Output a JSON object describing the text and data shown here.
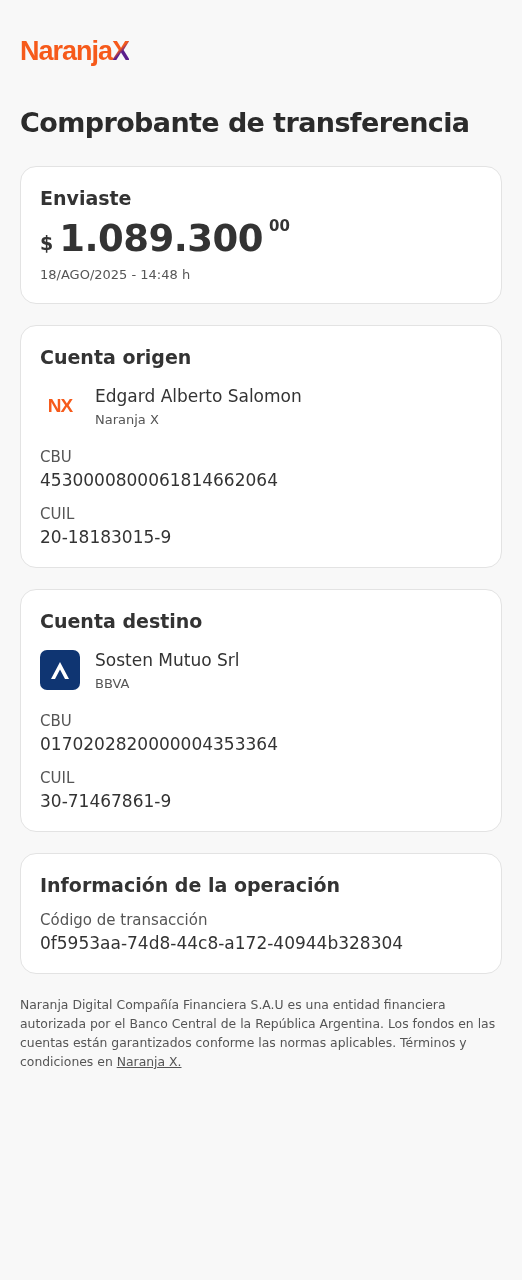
{
  "logo": {
    "name": "Naranja",
    "mark": "X"
  },
  "title": "Comprobante de transferencia",
  "summary": {
    "label": "Enviaste",
    "currency": "$",
    "amount": "1.089.300",
    "cents": "00",
    "datetime": "18/AGO/2025 - 14:48 h"
  },
  "accounts": [
    {
      "title": "Cuenta origen",
      "kind": "naranja",
      "logo_text": "NX",
      "holder": "Edgard Alberto Salomon",
      "bank": "Naranja X",
      "fields": [
        {
          "label": "CBU",
          "value": "4530000800061814662064"
        },
        {
          "label": "CUIL",
          "value": "20-18183015-9"
        }
      ]
    },
    {
      "title": "Cuenta destino",
      "kind": "bank",
      "holder": "Sosten Mutuo Srl",
      "bank": "BBVA",
      "fields": [
        {
          "label": "CBU",
          "value": "0170202820000004353364"
        },
        {
          "label": "CUIL",
          "value": "30-71467861-9"
        }
      ]
    }
  ],
  "operation": {
    "title": "Información de la operación",
    "fields": [
      {
        "label": "Código de transacción",
        "value": "0f5953aa-74d8-44c8-a172-40944b328304"
      }
    ]
  },
  "footer": {
    "text": "Naranja Digital Compañía Financiera S.A.U es una entidad financiera autorizada por el Banco Central de la República Argentina. Los fondos en las cuentas están garantizados conforme las normas aplicables. Términos y condiciones en ",
    "link": "Naranja X."
  }
}
